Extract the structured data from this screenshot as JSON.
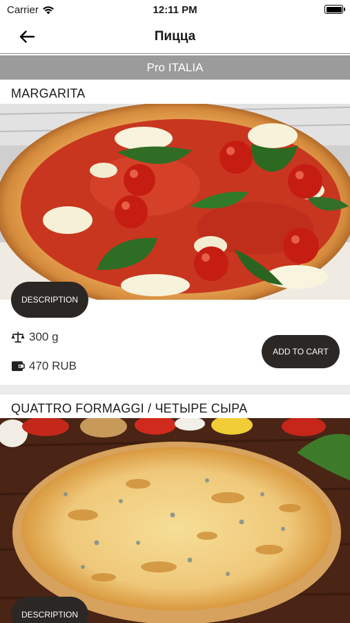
{
  "status": {
    "carrier": "Carrier",
    "time": "12:11 PM"
  },
  "nav": {
    "title": "Пицца"
  },
  "restaurant": {
    "name": "Pro ITALIA"
  },
  "items": [
    {
      "title": "MARGARITA",
      "description_label": "DESCRIPTION",
      "weight": "300 g",
      "price": "470 RUB",
      "add_label": "ADD TO CART"
    },
    {
      "title": "QUATTRO FORMAGGI / ЧЕТЫРЕ СЫРА",
      "description_label": "DESCRIPTION"
    }
  ],
  "colors": {
    "button_dark": "#2b2724",
    "restaurant_bar": "#9b9b9b",
    "separator": "#ececec"
  }
}
